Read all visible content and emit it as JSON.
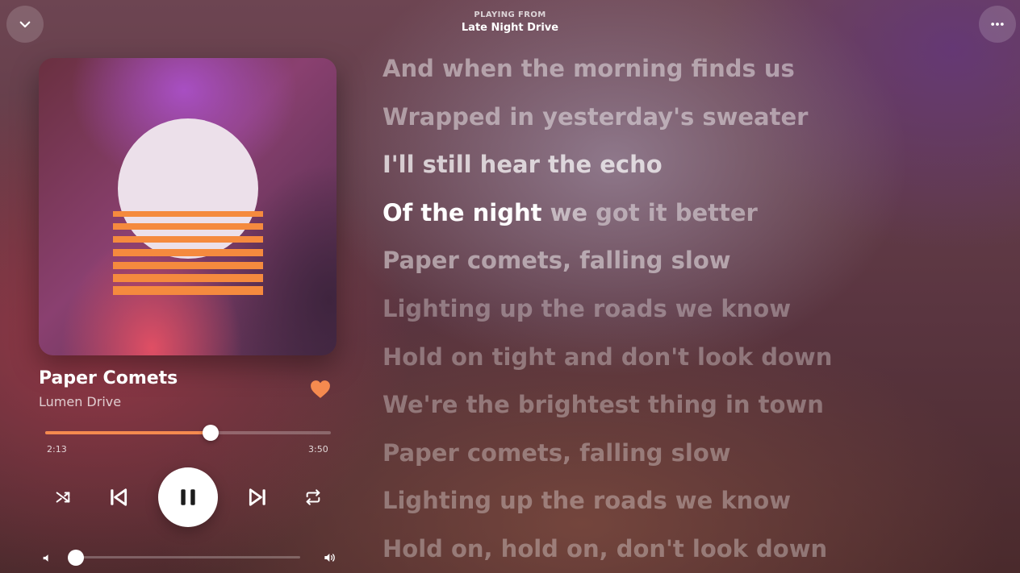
{
  "header": {
    "playing_from_label": "PLAYING FROM",
    "playlist_name": "Late Night Drive"
  },
  "icons": {
    "collapse": "chevron-down-icon",
    "more": "more-horizontal-icon",
    "like": "heart-icon",
    "shuffle": "shuffle-icon",
    "previous": "skip-previous-icon",
    "play_pause": "pause-icon",
    "next": "skip-next-icon",
    "repeat": "repeat-icon",
    "volume_low": "volume-low-icon",
    "volume_high": "volume-high-icon"
  },
  "track": {
    "title": "Paper Comets",
    "artist": "Lumen Drive",
    "liked": true
  },
  "playback": {
    "elapsed": "2:13",
    "total": "3:50",
    "progress_fraction": 0.578,
    "volume_fraction": 0.0,
    "state": "playing"
  },
  "colors": {
    "accent": "#f58a4f",
    "album_sun": "#ece0ea",
    "album_stripes": "#f58a3e"
  },
  "lyrics": [
    {
      "text": "And when the morning finds us",
      "state": "past"
    },
    {
      "text": "Wrapped in yesterday's sweater",
      "state": "past"
    },
    {
      "text": "I'll still hear the echo",
      "state": "near"
    },
    {
      "sung": "Of the night",
      "mid": " we",
      "rest": " got it better",
      "state": "active"
    },
    {
      "text": "Paper comets, falling slow",
      "state": "upcoming"
    },
    {
      "text": "Lighting up the roads we know",
      "state": "future"
    },
    {
      "text": "Hold on tight and don't look down",
      "state": "future"
    },
    {
      "text": "We're the brightest thing in town",
      "state": "future"
    },
    {
      "text": "Paper comets, falling slow",
      "state": "future"
    },
    {
      "text": "Lighting up the roads we know",
      "state": "future"
    },
    {
      "text": "Hold on, hold on, don't look down",
      "state": "future"
    }
  ]
}
